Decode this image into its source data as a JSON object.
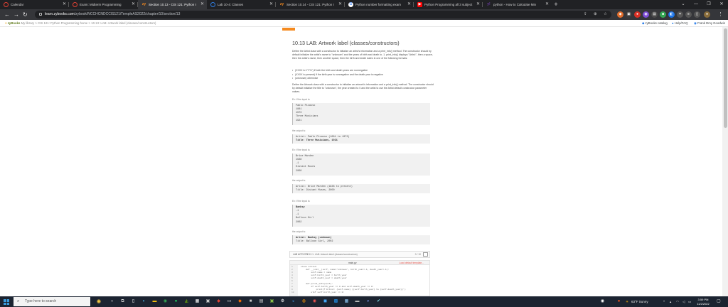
{
  "browser": {
    "tabs": [
      {
        "label": "Calendar",
        "icon": "red-ring-icon",
        "active": false
      },
      {
        "label": "Exam: Midterm Programming",
        "icon": "red-ring-icon",
        "active": false
      },
      {
        "label": "Section 10.13 - CIS 121: Python I",
        "icon": "zybooks-icon",
        "active": true
      },
      {
        "label": "Lab 10-4: Classes",
        "icon": "blue-ring-icon",
        "active": false
      },
      {
        "label": "Section 10.14 - CIS 121: Python I",
        "icon": "zybooks-icon",
        "active": false
      },
      {
        "label": "Python number formatting exam",
        "icon": "google-icon",
        "active": false
      },
      {
        "label": "Python Programming all 3 subject",
        "icon": "youtube-icon",
        "active": false
      },
      {
        "label": "python - How to Calculate Min",
        "icon": "yahoo-icon",
        "active": false
      }
    ],
    "url_domain": "learn.zybooks.com",
    "url_path": "/zybook/NCCHCNDCCIS121/TempleAS2022/chapter/10/section/13",
    "breadcrumb_brand": "zyBooks",
    "breadcrumb": "My library > CIS 121: Python Programming home > 10.13: LAB: Artwork label (classes/constructors)",
    "bookmarks": [
      "zyBooks catalog",
      "Help/FAQ",
      "Frank Dmy Goodwin"
    ]
  },
  "page": {
    "title": "10.13 LAB: Artwork label (classes/constructors)",
    "intro": "Define the Artist class with a constructor to initialize an artist's information and a print_info() method. The constructor should by default initialize the artist's name to \"unknown\" and the years of birth and death to -1. print_info() displays \"Artist:\", then a space, then the artist's name, then another space, then the birth and death dates in one of the following formats:",
    "bullets": [
      "(XXXX to YYYY) if both the birth and death years are nonnegative",
      "(XXXX to present) if the birth year is nonnegative and the death year is negative",
      "(unknown) otherwise"
    ],
    "intro2": "Define the Artwork class with a constructor to initialize an artwork's information and a print_info() method. The constructor should by default initialize the title to \"unknown\", the year created to 0 and the artist to use the Artist default constructor parameter values.",
    "ex1_label": "Ex: If the input is:",
    "ex1_input": [
      "Pablo Picasso",
      "1881",
      "1973",
      "Three Musicians",
      "1921"
    ],
    "ex1_out_label": "the output is:",
    "ex1_output": [
      "Artist: Pablo Picasso (1881 to 1973)",
      "Title: Three Musicians, 1921"
    ],
    "ex2_label": "Ex: If the input is:",
    "ex2_input": [
      "Brice Marden",
      "1938",
      "-1",
      "Distant Muses",
      "2000"
    ],
    "ex2_out_label": "the output is:",
    "ex2_output": [
      "Artist: Brice Marden (1938 to present)",
      "Title: Distant Muses, 2000"
    ],
    "ex3_label": "Ex: If the input is:",
    "ex3_input": [
      "Banksy",
      "-1",
      "-1",
      "Balloon Girl",
      "2002"
    ],
    "ex3_out_label": "the output is:",
    "ex3_output": [
      "Artist: Banksy (unknown)",
      "Title: Balloon Girl, 2002"
    ]
  },
  "editor": {
    "activity_label": "LAB ACTIVITY",
    "activity_title": "10.13.1: LAB: Artwork label (classes/constructors)",
    "score": "0 / 10",
    "filename": "main.py",
    "load_template": "Load default template...",
    "line_numbers": [
      "1",
      "2",
      "3",
      "4",
      "5",
      "6",
      "7",
      "8",
      "9",
      "10"
    ],
    "code_lines": [
      "class Artist:",
      "    def __init__(self, name='unknown', birth_year=-1, death_year=-1):",
      "        self.name = name",
      "        self.birth_year = birth_year",
      "        self.death_year = death_year",
      "",
      "    def print_info(self):",
      "        if self.birth_year >= 0 and self.death_year >= 0:",
      "            print(f'Artist: {self.name} ({self.birth_year} to {self.death_year})')",
      "        elif self.birth_year >= 0:"
    ]
  },
  "taskbar": {
    "search_placeholder": "Type here to search",
    "weather": "63°F  Sunny",
    "time": "3:59 PM",
    "date": "11/2/2022"
  }
}
